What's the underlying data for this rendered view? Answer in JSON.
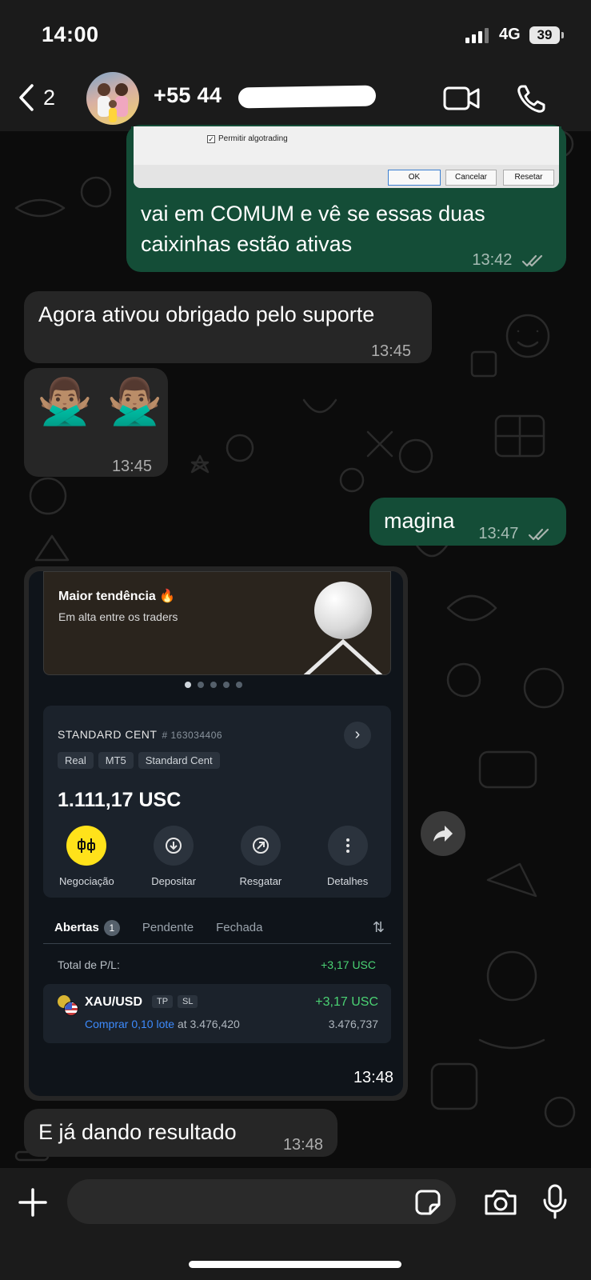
{
  "status_bar": {
    "time": "14:00",
    "network": "4G",
    "battery": "39"
  },
  "header": {
    "back_count": "2",
    "contact_number": "+55 44"
  },
  "screenshot_dialog": {
    "checkbox_label": "Permitir algotrading",
    "ok": "OK",
    "cancel": "Cancelar",
    "reset": "Resetar"
  },
  "messages": [
    {
      "direction": "out",
      "text_line1": "vai em COMUM e vê se essas duas",
      "text_line2": "caixinhas estão ativas",
      "time": "13:42",
      "read": true
    },
    {
      "direction": "in",
      "text": "Agora ativou obrigado pelo suporte",
      "time": "13:45"
    },
    {
      "direction": "in",
      "emoji": "🙅🏽‍♂️",
      "time": "13:45"
    },
    {
      "direction": "out",
      "text": "magina",
      "time": "13:47",
      "read": true
    },
    {
      "direction": "in",
      "type": "image",
      "time": "13:48"
    },
    {
      "direction": "in",
      "text": "E já dando resultado",
      "time": "13:48"
    }
  ],
  "trading_app": {
    "banner_title": "Maior tendência 🔥",
    "banner_subtitle": "Em alta entre os traders",
    "account_name": "STANDARD CENT",
    "account_number": "# 163034406",
    "tags": [
      "Real",
      "MT5",
      "Standard Cent"
    ],
    "balance": "1.111,17 USC",
    "actions": [
      "Negociação",
      "Depositar",
      "Resgatar",
      "Detalhes"
    ],
    "tabs": {
      "open": "Abertas",
      "open_count": "1",
      "pending": "Pendente",
      "closed": "Fechada"
    },
    "pl_label": "Total de P/L:",
    "pl_value": "+3,17 USC",
    "trade": {
      "symbol": "XAU/USD",
      "tp": "TP",
      "sl": "SL",
      "pnl": "+3,17 USC",
      "order": "Comprar 0,10 lote",
      "at": "at 3.476,420",
      "current": "3.476,737"
    }
  },
  "input": {
    "placeholder": ""
  },
  "icons": [
    "chevron-left-icon",
    "video-call-icon",
    "phone-icon",
    "forward-icon",
    "plus-icon",
    "sticker-icon",
    "camera-icon",
    "microphone-icon"
  ],
  "colors": {
    "outgoing_bubble": "#144d37",
    "incoming_bubble": "#262626",
    "positive": "#4bd374",
    "accent_yellow": "#ffe21a",
    "buy_blue": "#3d8bfd"
  }
}
